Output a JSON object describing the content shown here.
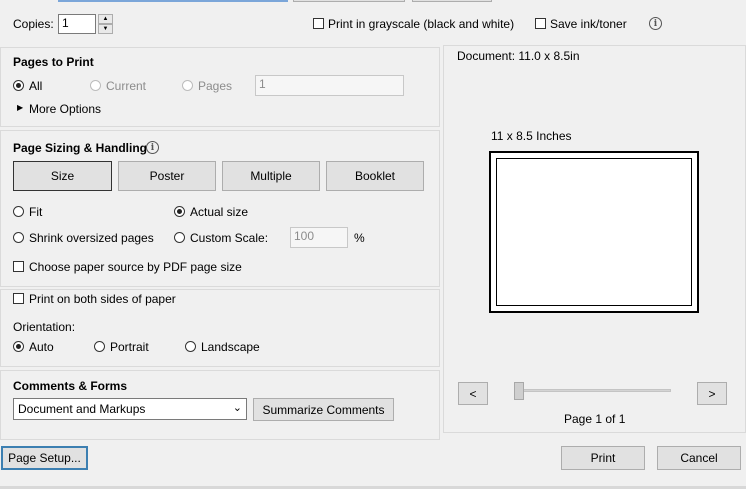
{
  "copies": {
    "label": "Copies:",
    "value": "1"
  },
  "options": {
    "grayscale_label": "Print in grayscale (black and white)",
    "save_ink_label": "Save ink/toner"
  },
  "pages_to_print": {
    "title": "Pages to Print",
    "all_label": "All",
    "current_label": "Current",
    "pages_label": "Pages",
    "pages_value": "1",
    "more_options_label": "More Options"
  },
  "sizing": {
    "title": "Page Sizing & Handling",
    "buttons": [
      "Size",
      "Poster",
      "Multiple",
      "Booklet"
    ],
    "fit_label": "Fit",
    "actual_size_label": "Actual size",
    "shrink_label": "Shrink oversized pages",
    "custom_scale_label": "Custom Scale:",
    "custom_scale_value": "100",
    "percent": "%",
    "paper_source_label": "Choose paper source by PDF page size"
  },
  "duplex": {
    "label": "Print on both sides of paper"
  },
  "orientation": {
    "title": "Orientation:",
    "auto_label": "Auto",
    "portrait_label": "Portrait",
    "landscape_label": "Landscape"
  },
  "comments": {
    "title": "Comments & Forms",
    "selected": "Document and Markups",
    "summarize_label": "Summarize Comments"
  },
  "preview": {
    "doc_size": "Document: 11.0 x 8.5in",
    "paper_label": "11 x 8.5 Inches",
    "prev": "<",
    "next": ">",
    "page_info": "Page 1 of 1",
    "slider_position": 0
  },
  "footer": {
    "page_setup_label": "Page Setup...",
    "print_label": "Print",
    "cancel_label": "Cancel"
  }
}
